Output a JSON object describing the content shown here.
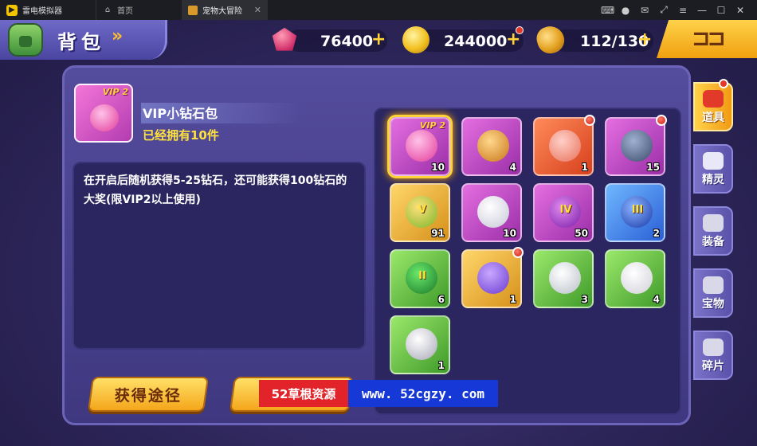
{
  "emulator": {
    "app_name": "雷电模拟器",
    "tabs": [
      {
        "label": "首页"
      },
      {
        "label": "宠物大冒险"
      }
    ]
  },
  "header": {
    "title": "背包",
    "title_arrows": "»",
    "currencies": [
      {
        "icon": "diamond-icon",
        "value": "76400",
        "plus": "+"
      },
      {
        "icon": "gold-coin-icon",
        "value": "244000",
        "plus": "+"
      },
      {
        "icon": "stamina-icon",
        "value": "112/130",
        "plus": "+"
      }
    ]
  },
  "selected_item": {
    "vip_tag": "VIP 2",
    "name": "VIP小钻石包",
    "owned": "已经拥有10件",
    "description": "在开启后随机获得5-25钻石，还可能获得100钻石的大奖(限VIP2以上使用)"
  },
  "buttons": {
    "obtain": "获得途径"
  },
  "items": [
    {
      "icon": "vip-diamond-pack-icon",
      "color": "purple",
      "qty": "10",
      "vip": "VIP 2",
      "selected": true,
      "badge": false
    },
    {
      "icon": "bread-icon",
      "color": "purple",
      "qty": "4",
      "badge": false
    },
    {
      "icon": "feather-wing-icon",
      "color": "orange",
      "qty": "1",
      "badge": true
    },
    {
      "icon": "treasure-chest-icon",
      "color": "purple",
      "qty": "15",
      "badge": true
    },
    {
      "icon": "fruit-v-icon",
      "color": "gold",
      "qty": "91",
      "roman": "V",
      "badge": false
    },
    {
      "icon": "white-feather-icon",
      "color": "purple",
      "qty": "10",
      "badge": false
    },
    {
      "icon": "fruit-iv-icon",
      "color": "purple",
      "qty": "50",
      "roman": "IV",
      "badge": false
    },
    {
      "icon": "fruit-iii-icon",
      "color": "blue",
      "qty": "2",
      "roman": "III",
      "badge": false
    },
    {
      "icon": "fruit-ii-icon",
      "color": "green",
      "qty": "6",
      "roman": "II",
      "badge": false
    },
    {
      "icon": "gem-box-icon",
      "color": "gold",
      "qty": "1",
      "badge": true
    },
    {
      "icon": "octagon-stone-icon",
      "color": "green",
      "qty": "3",
      "badge": false
    },
    {
      "icon": "shell-icon",
      "color": "green",
      "qty": "4",
      "badge": false
    },
    {
      "icon": "pearl-icon",
      "color": "green",
      "qty": "1",
      "badge": false
    }
  ],
  "side_tabs": [
    {
      "label": "道具",
      "icon": "pokeball-icon",
      "active": true
    },
    {
      "label": "精灵",
      "icon": "cap-icon",
      "active": false
    },
    {
      "label": "装备",
      "icon": "armor-icon",
      "active": false
    },
    {
      "label": "宝物",
      "icon": "key-icon",
      "active": false
    },
    {
      "label": "碎片",
      "icon": "puzzle-icon",
      "active": false
    }
  ],
  "watermark": {
    "brand": "52草根资源",
    "url": "www. 52cgzy. com"
  },
  "colors": {
    "accent_gold": "#ffd23a",
    "panel_purple": "#544c9c",
    "badge_red": "#e23a2a"
  }
}
